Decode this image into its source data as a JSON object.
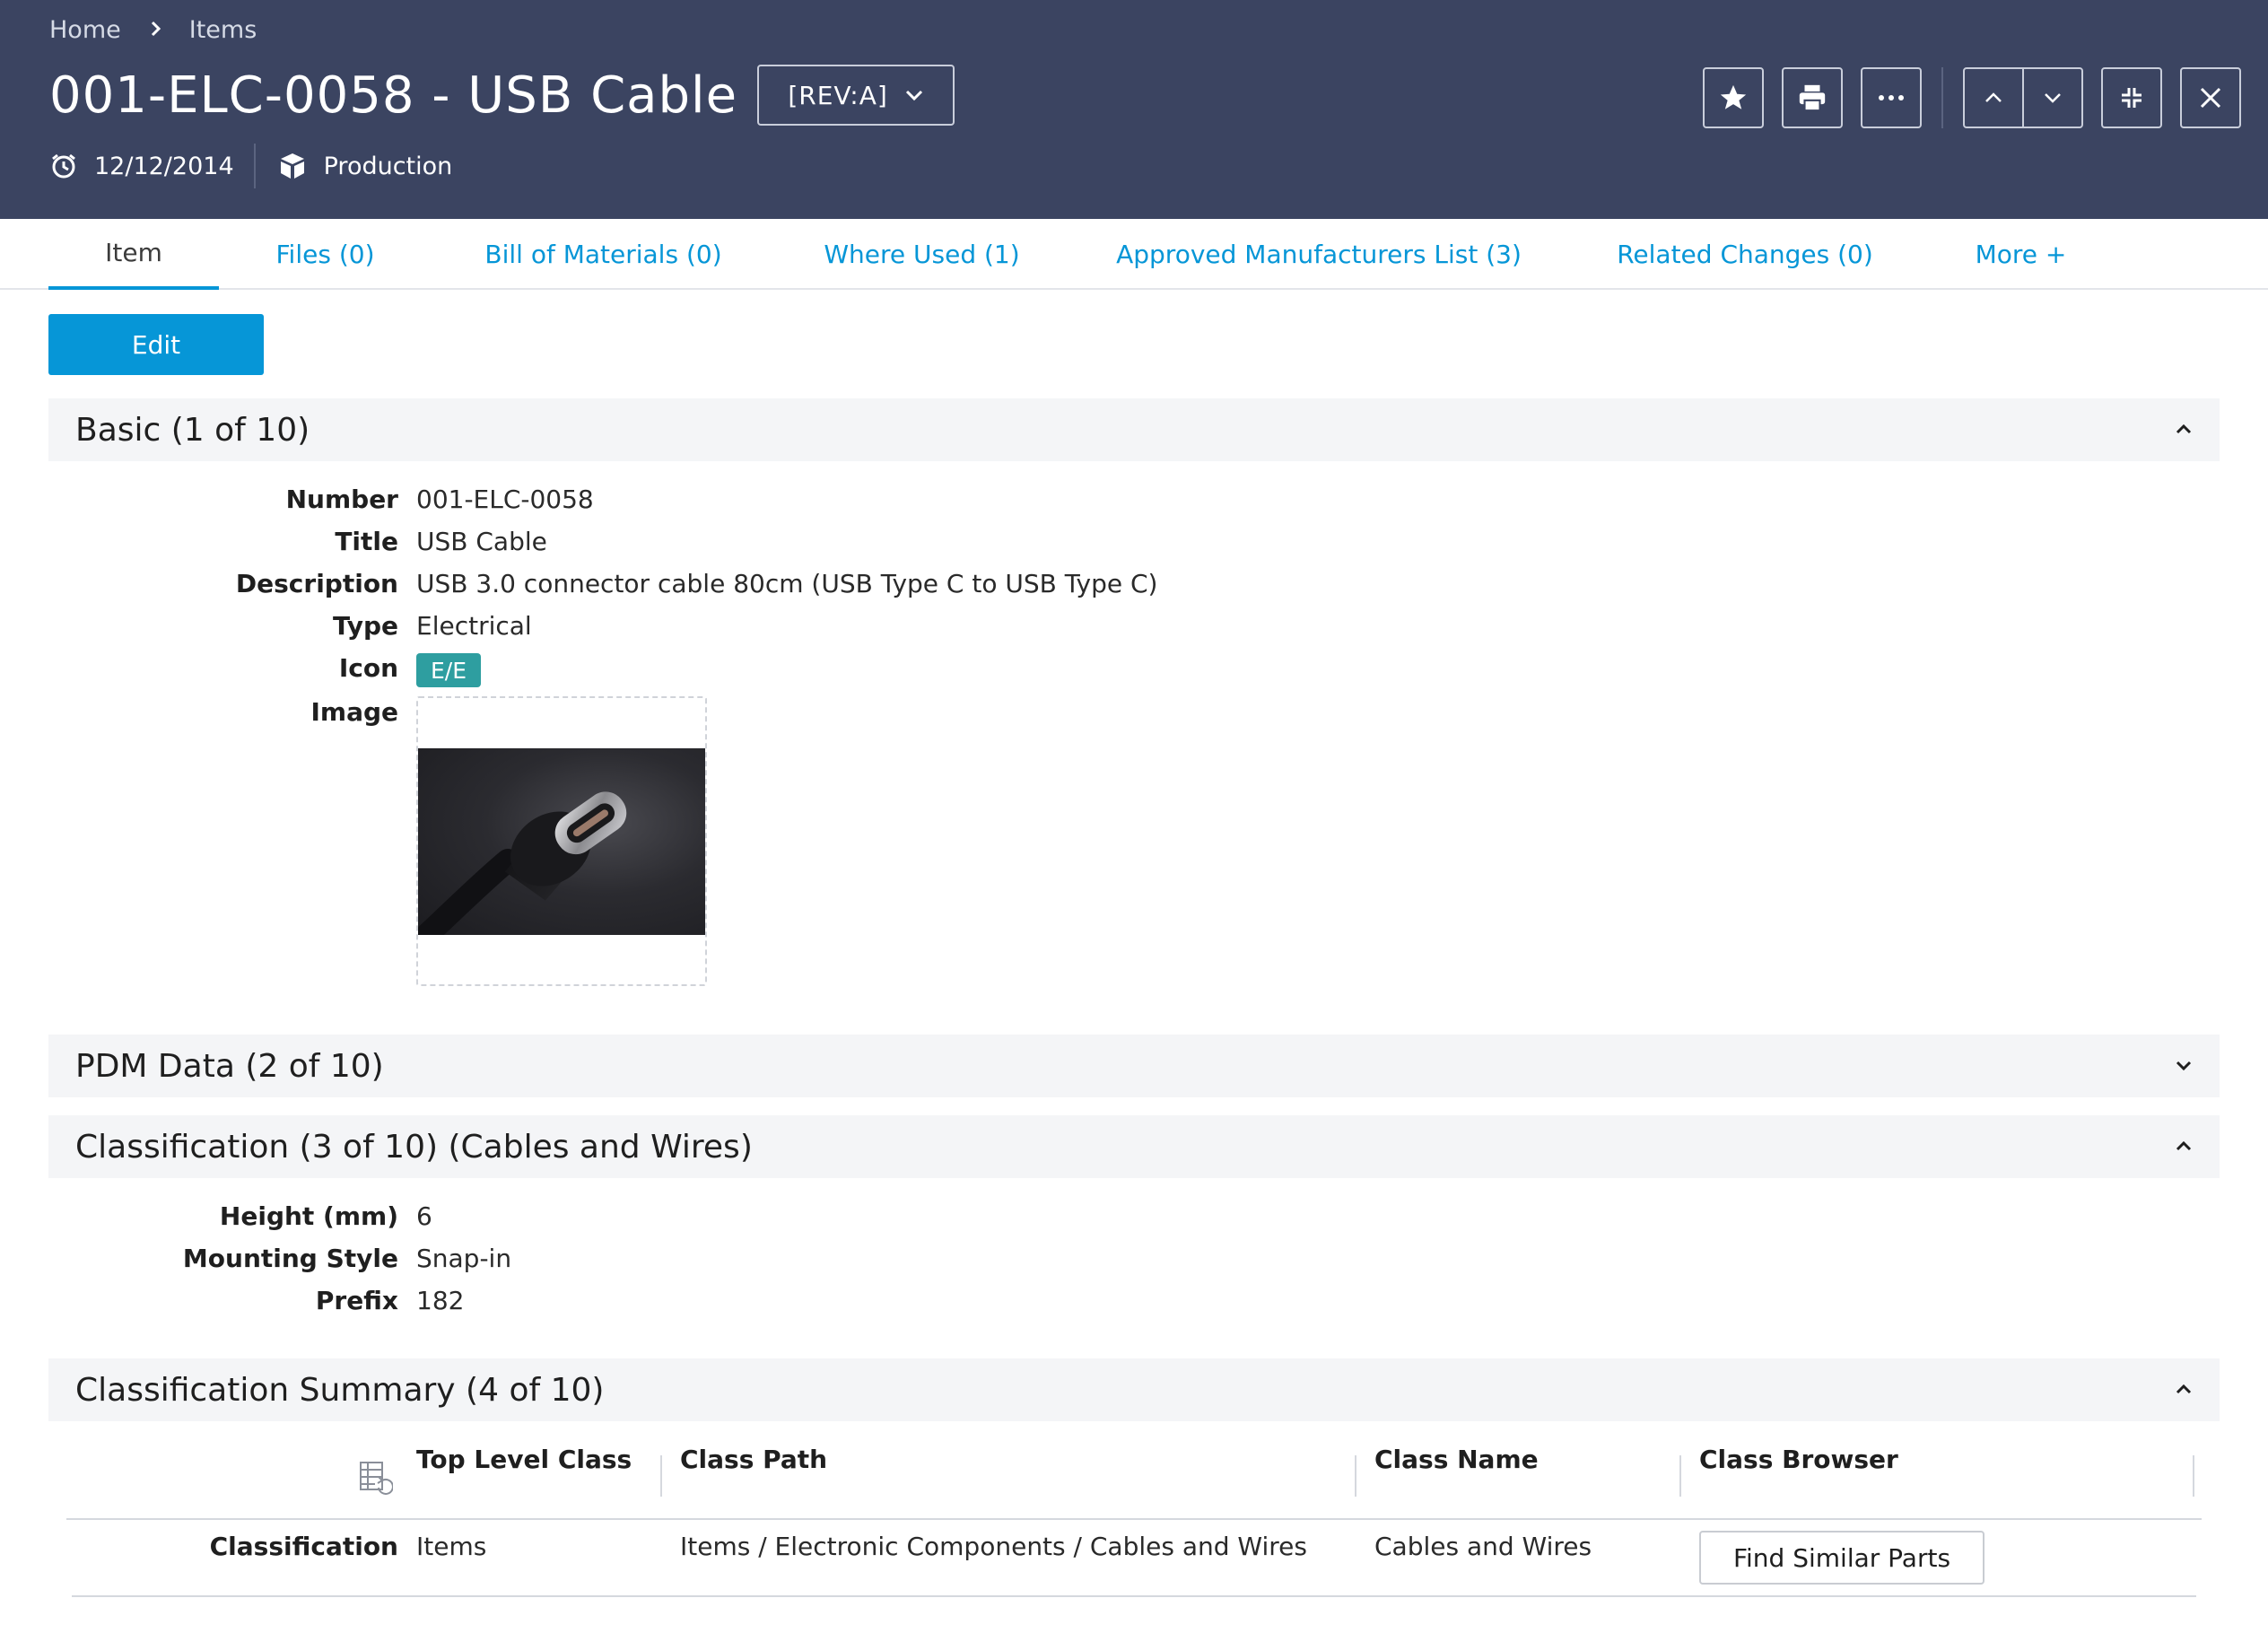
{
  "breadcrumb": {
    "home": "Home",
    "items": "Items"
  },
  "header": {
    "title": "001-ELC-0058 - USB Cable",
    "revision": "[REV:A]",
    "date": "12/12/2014",
    "lifecycle": "Production"
  },
  "tabs": [
    {
      "label": "Item",
      "active": true
    },
    {
      "label": "Files (0)"
    },
    {
      "label": "Bill of Materials (0)"
    },
    {
      "label": "Where Used (1)"
    },
    {
      "label": "Approved Manufacturers List (3)"
    },
    {
      "label": "Related Changes (0)"
    },
    {
      "label": "More +"
    }
  ],
  "edit_label": "Edit",
  "sections": {
    "basic": {
      "title": "Basic (1 of 10)",
      "fields": [
        {
          "label": "Number",
          "value": "001-ELC-0058"
        },
        {
          "label": "Title",
          "value": "USB Cable"
        },
        {
          "label": "Description",
          "value": "USB 3.0 connector cable 80cm (USB Type C to USB Type C)"
        },
        {
          "label": "Type",
          "value": "Electrical"
        },
        {
          "label": "Icon",
          "value": "E/E"
        },
        {
          "label": "Image"
        }
      ]
    },
    "pdm": {
      "title": "PDM Data (2 of 10)"
    },
    "classification": {
      "title": "Classification (3 of 10) (Cables and Wires)",
      "fields": [
        {
          "label": "Height (mm)",
          "value": "6"
        },
        {
          "label": "Mounting Style",
          "value": "Snap-in"
        },
        {
          "label": "Prefix",
          "value": "182"
        }
      ]
    },
    "summary": {
      "title": "Classification Summary (4 of 10)",
      "columns": [
        "Top Level Class",
        "Class Path",
        "Class Name",
        "Class Browser"
      ],
      "row": {
        "label": "Classification",
        "top_level_class": "Items",
        "class_path": "Items / Electronic Components / Cables and Wires",
        "class_name": "Cables and Wires",
        "button": "Find Similar Parts"
      }
    }
  },
  "colors": {
    "header_bg": "#3b4461",
    "accent": "#0696d7",
    "icon_badge": "#2e9ea0",
    "section_bg": "#f4f5f7"
  },
  "icons": [
    "chevron-right-icon",
    "chevron-down-icon",
    "clock-icon",
    "cube-icon",
    "star-icon",
    "print-icon",
    "more-icon",
    "chevron-up-icon",
    "collapse-icon",
    "close-icon",
    "table-reset-icon"
  ]
}
